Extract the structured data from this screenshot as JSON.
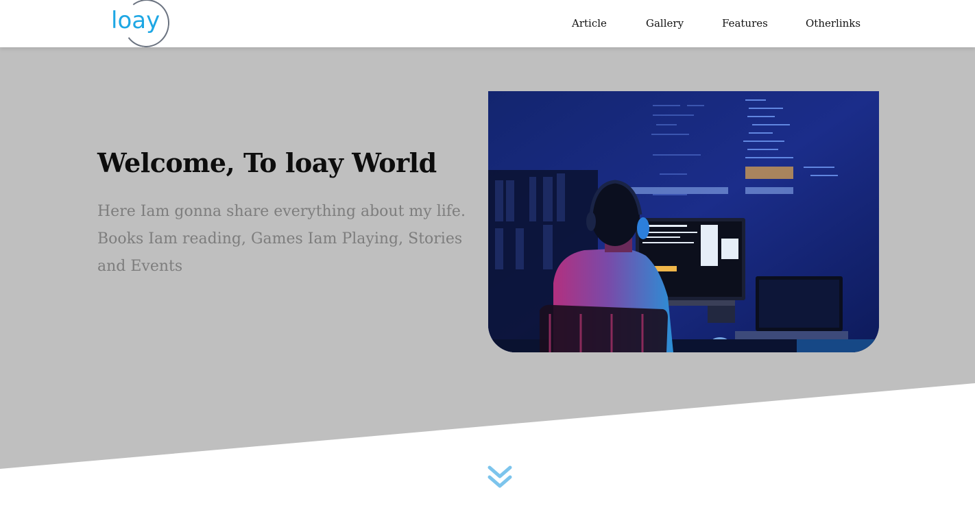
{
  "header": {
    "logo_text": "loay",
    "nav": {
      "article": "Article",
      "gallery": "Gallery",
      "features": "Features",
      "otherlinks": "Otherlinks"
    }
  },
  "hero": {
    "title": "Welcome, To loay World",
    "description": "Here Iam gonna share everything about my life. Books Iam reading, Games Iam Playing, Stories and Events",
    "image_alt_icon": "programmer-at-computer-image"
  },
  "scroll": {
    "icon": "double-chevron-down-icon"
  },
  "colors": {
    "brand_blue": "#1ea7e4",
    "hero_background": "#bfbfbf",
    "chevron": "#7cc4ec"
  }
}
